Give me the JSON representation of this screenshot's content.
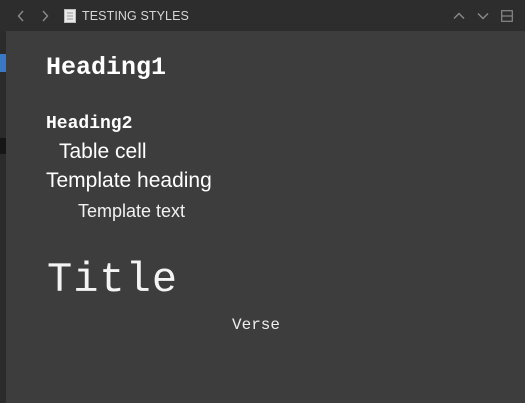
{
  "window": {
    "title": "TESTING STYLES",
    "colors": {
      "titlebar_bg": "#2d2d2d",
      "content_bg": "#3d3d3d",
      "title_text": "#d6d6d6",
      "icon": "#9a9a9a",
      "accent_left": "#3a78c4"
    },
    "icons": {
      "back": "chevron-left-icon",
      "forward": "chevron-right-icon",
      "document": "document-icon",
      "collapse": "chevron-up-icon",
      "expand": "chevron-down-icon",
      "pane": "split-pane-icon"
    }
  },
  "content": {
    "heading1": "Heading1",
    "heading2": "Heading2",
    "table_cell": "Table cell",
    "template_heading": "Template heading",
    "template_text": "Template text",
    "title": "Title",
    "verse": "Verse"
  }
}
